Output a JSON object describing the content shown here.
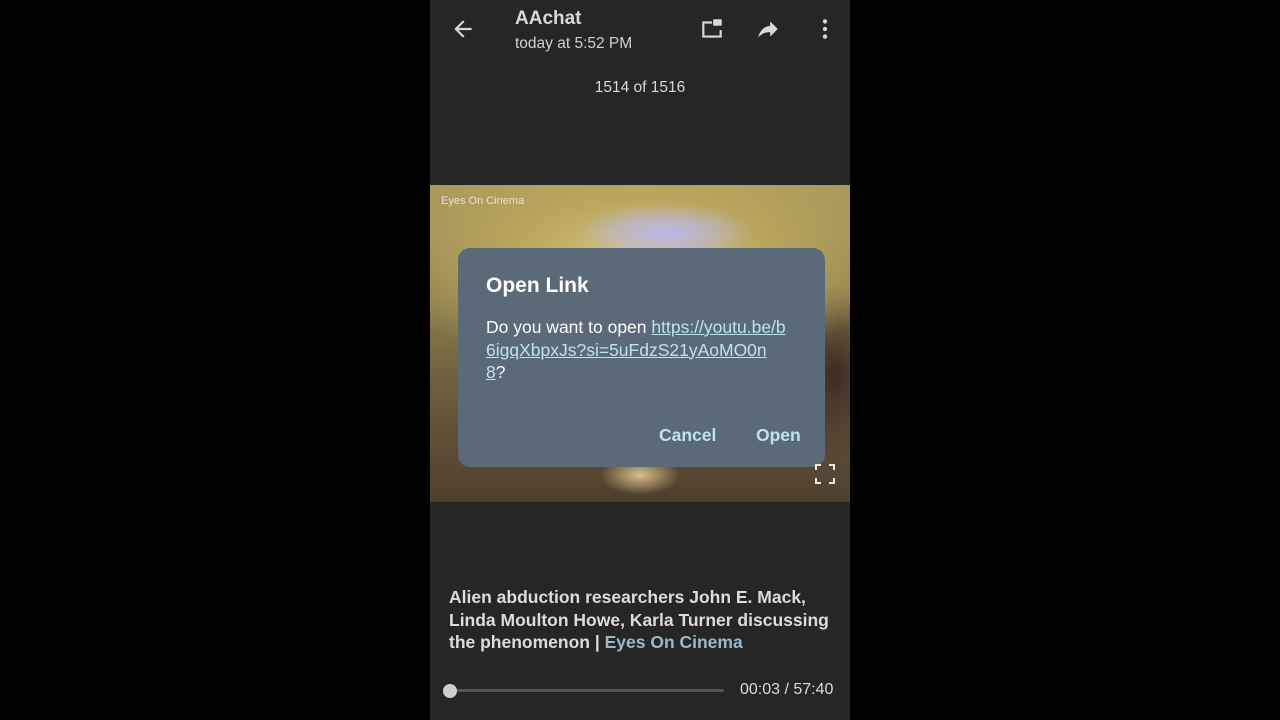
{
  "header": {
    "back_icon": "arrow-left-icon",
    "title": "AAchat",
    "subtitle": "today at 5:52 PM",
    "actions": [
      {
        "name": "picture-in-picture",
        "icon": "pip-icon"
      },
      {
        "name": "share",
        "icon": "share-arrow-icon"
      },
      {
        "name": "more",
        "icon": "more-vertical-icon"
      }
    ]
  },
  "counter": "1514 of 1516",
  "video": {
    "watermark": "Eyes On Cinema",
    "fullscreen_icon": "fullscreen-icon"
  },
  "dialog": {
    "title": "Open Link",
    "prompt": "Do you want to open ",
    "url": "https://youtu.be/b6igqXbpxJs?si=5uFdzS21yAoMO0n8",
    "suffix": "?",
    "cancel_label": "Cancel",
    "open_label": "Open",
    "accent_color": "#bfe2f2"
  },
  "caption": {
    "text": "Alien abduction researchers John E. Mack, Linda Moulton Howe, Karla Turner discussing the phenomenon | ",
    "source": "Eyes On Cinema"
  },
  "player": {
    "current_time": "00:03",
    "duration": "57:40",
    "time_display": "00:03 / 57:40",
    "progress_fraction": 0.0009
  }
}
